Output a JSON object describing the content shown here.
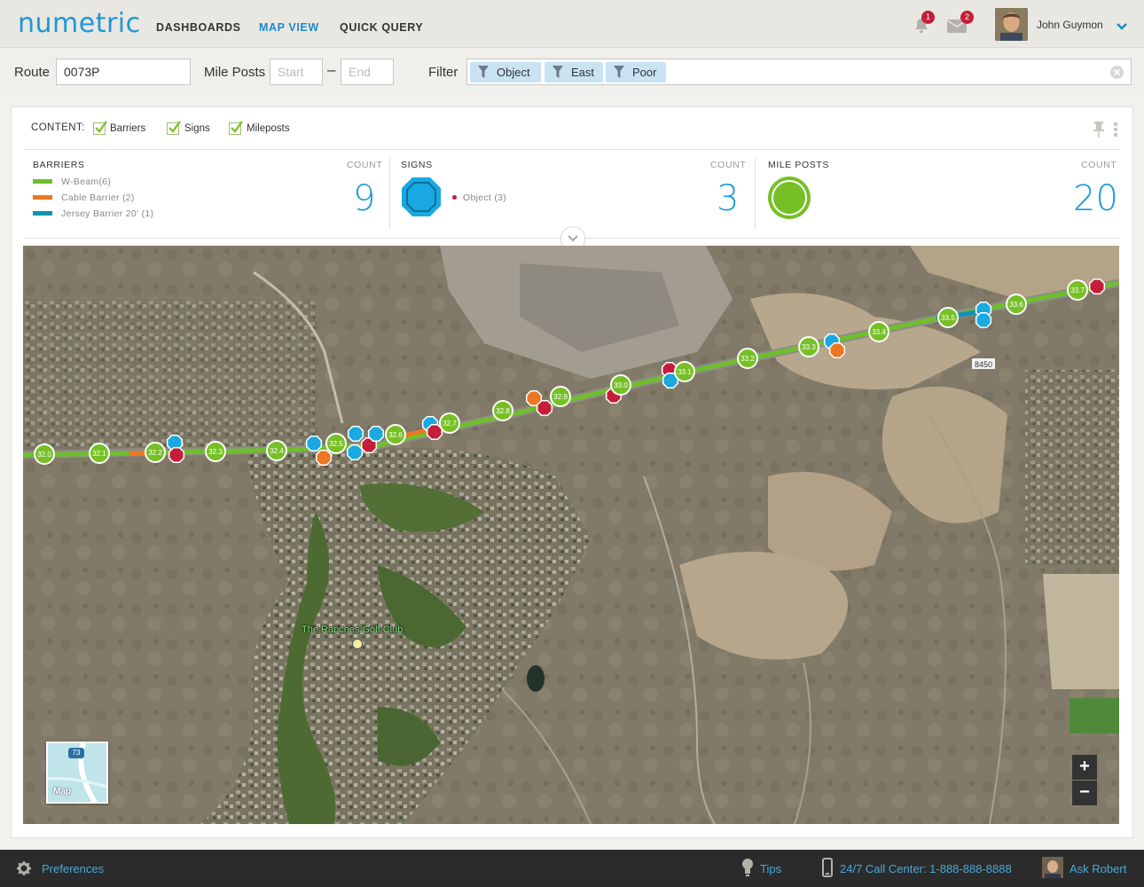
{
  "app": {
    "logo": "numetric"
  },
  "nav": {
    "links": [
      {
        "label": "DASHBOARDS",
        "active": false
      },
      {
        "label": "MAP VIEW",
        "active": true
      },
      {
        "label": "QUICK QUERY",
        "active": false
      }
    ],
    "notifications_count": "1",
    "messages_count": "2",
    "user_name": "John Guymon"
  },
  "filterbar": {
    "route_label": "Route",
    "route_value": "0073P",
    "mileposts_label": "Mile Posts",
    "start_placeholder": "Start",
    "separator": "–",
    "end_placeholder": "End",
    "filter_label": "Filter",
    "filters": [
      "Object",
      "East",
      "Poor"
    ]
  },
  "content": {
    "label": "CONTENT:",
    "toggles": [
      {
        "label": "Barriers",
        "checked": true
      },
      {
        "label": "Signs",
        "checked": true
      },
      {
        "label": "Mileposts",
        "checked": true
      }
    ]
  },
  "stats": {
    "barriers": {
      "title": "BARRIERS",
      "count_label": "COUNT",
      "count": "9",
      "legend": [
        {
          "label": "W-Beam(6)",
          "color": "#6fbf2a"
        },
        {
          "label": "Cable Barrier (2)",
          "color": "#ee7623"
        },
        {
          "label": "Jersey Barrier 20' (1)",
          "color": "#0e93b4"
        }
      ]
    },
    "signs": {
      "title": "SIGNS",
      "count_label": "COUNT",
      "count": "3",
      "legend": [
        {
          "label": "Object (3)",
          "color": "#c41e3a"
        }
      ],
      "icon_color": "#1aa8e0"
    },
    "mileposts": {
      "title": "MILE  POSTS",
      "count_label": "COUNT",
      "count": "20",
      "icon_color": "#76c026"
    }
  },
  "map": {
    "place_label": "The Ranches Golf Club",
    "road_shield": "8450",
    "minimap_label": "Map",
    "minimap_route": "73",
    "zoom_in": "+",
    "zoom_out": "−",
    "mileposts": [
      "32.0",
      "32.1",
      "32.2",
      "32.3",
      "32.4",
      "32.5",
      "32.6",
      "32.7",
      "32.8",
      "32.9",
      "33.0",
      "33.1",
      "33.2",
      "33.3",
      "33.4",
      "33.5",
      "33.6",
      "33.7"
    ]
  },
  "footer": {
    "preferences": "Preferences",
    "tips": "Tips",
    "call_center": "24/7 Call Center: 1-888-888-8888",
    "ask": "Ask Robert"
  },
  "colors": {
    "accent": "#1a9ad6",
    "milepost_green": "#76c026",
    "sign_blue": "#1aa8e0",
    "sign_red": "#c41e3a",
    "cable_orange": "#ee7623"
  }
}
